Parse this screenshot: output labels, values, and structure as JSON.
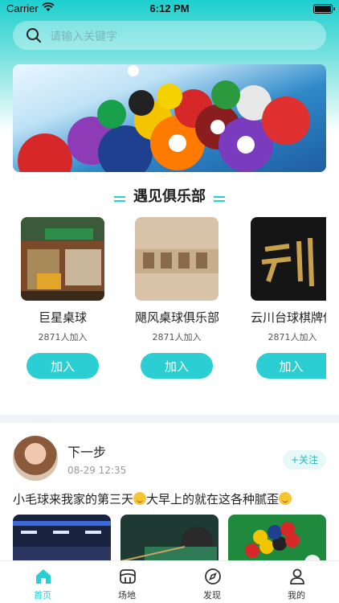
{
  "status_bar": {
    "carrier": "Carrier",
    "time": "6:12 PM"
  },
  "search": {
    "placeholder": "请输入关键字"
  },
  "section": {
    "title": "遇见俱乐部"
  },
  "clubs": [
    {
      "name": "巨星桌球",
      "members": "2871人加入",
      "join_label": "加入"
    },
    {
      "name": "飓风桌球俱乐部",
      "members": "2871人加入",
      "join_label": "加入"
    },
    {
      "name": "云川台球棋牌俱",
      "members": "2871人加入",
      "join_label": "加入"
    }
  ],
  "post": {
    "author": "下一步",
    "date": "08-29 12:35",
    "follow_label": "+关注",
    "text_part1": "小毛球来我家的第三天",
    "text_part2": "大早上的就在这各种腻歪"
  },
  "tabbar": [
    {
      "label": "首页",
      "icon": "home-icon",
      "active": true
    },
    {
      "label": "场地",
      "icon": "venue-icon",
      "active": false
    },
    {
      "label": "发现",
      "icon": "compass-icon",
      "active": false
    },
    {
      "label": "我的",
      "icon": "user-icon",
      "active": false
    }
  ],
  "colors": {
    "accent": "#2bcfd3",
    "header_top": "#1ccfcf"
  }
}
